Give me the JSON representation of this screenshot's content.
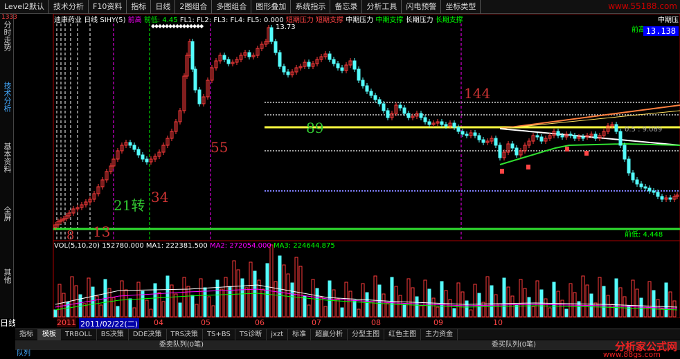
{
  "topbar": {
    "items": [
      "Level2默认",
      "技术分析",
      "F10资料",
      "指标",
      "日线",
      "2图组合",
      "多图组合",
      "图形叠加",
      "系统指示",
      "备忘录",
      "分析工具",
      "闪电预警",
      "坐标类型"
    ],
    "logo": "www.55188.com"
  },
  "sidebar": {
    "tabs": [
      "分时走势",
      "技术分析",
      "基本资料",
      "全屏",
      "其他"
    ],
    "active": 1,
    "top_number": "1333"
  },
  "infobar": {
    "stock": "迪康药业",
    "period": "日线",
    "indicator": "SIHY(5)",
    "front_high": "前高",
    "front_low": "前低: 4.45",
    "fl_labels": "FL1: FL2: FL3: FL4: FL5: 0.000",
    "short_press": "短期压力",
    "short_support": "短期支撑",
    "mid_press": "中期压力",
    "mid_support": "中期支撑",
    "long_press": "长期压力",
    "long_support": "长期支撑",
    "right_label": "中期压"
  },
  "price_label": "13.138",
  "peak_label": "13.73",
  "right_val": "前高",
  "fib_label": "0.5 : 9.089",
  "front_low_label": "前低: 4.448",
  "annotations": {
    "a144": "144",
    "a89": "89",
    "a55": "55",
    "a34": "34",
    "a21": "21转",
    "a13": "13",
    "a8": "8"
  },
  "vol": {
    "label": "VOL(5,10,20)",
    "value": "152780.000",
    "ma1": "MA1: 222381.500",
    "ma2": "MA2: 272054.000",
    "ma3": "MA3: 224644.875"
  },
  "datebar": {
    "start": "2011",
    "selected": "2011/02/22(二)",
    "months": [
      "04",
      "05",
      "06",
      "07",
      "08",
      "09",
      "10"
    ],
    "period_label": "日线"
  },
  "bottom_tabs": [
    "指标",
    "模板",
    "TRBOLL",
    "BS决策",
    "DDE决策",
    "TRS决策",
    "TS+BS",
    "TS诊断",
    "jxzt",
    "标准",
    "超赢分析",
    "分型主图",
    "红色主图",
    "主力资金"
  ],
  "active_bottom_tab": 1,
  "queue": {
    "left": "委卖队列(0笔)",
    "right": "委买队列(0笔)",
    "corner": "队列"
  },
  "watermark": {
    "logo": "分析家公式网",
    "url": "www.88gs.com"
  },
  "colors": {
    "up": "#ff3b3b",
    "down": "#54fcfc",
    "yellow_line": "#ffff40",
    "green_line": "#30e030",
    "dotted": "#a0a0a0",
    "purple_dotted": "#8080ff"
  }
}
